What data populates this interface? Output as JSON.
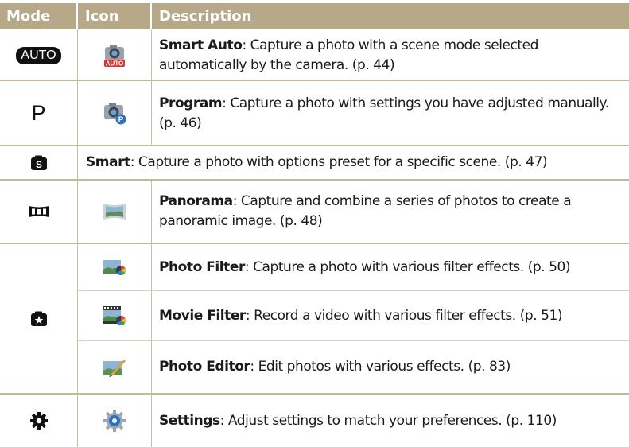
{
  "header": {
    "mode": "Mode",
    "icon": "Icon",
    "description": "Description"
  },
  "colors": {
    "header_bg": "#b7a88a",
    "rule": "#c4b89d"
  },
  "rows": [
    {
      "mode": "AUTO",
      "mode_icon": "auto-badge-icon",
      "icon": "smart-auto-camera-icon",
      "title": "Smart Auto",
      "text": ": Capture a photo with a scene mode selected automatically by the camera. (p. 44)"
    },
    {
      "mode": "P",
      "mode_icon": "program-p-icon",
      "icon": "program-camera-icon",
      "title": "Program",
      "text": ": Capture a photo with settings you have adjusted manually. (p. 46)"
    },
    {
      "mode_icon": "smart-mode-icon",
      "title": "Smart",
      "text": ": Capture a photo with options preset for a specific scene. (p. 47)"
    },
    {
      "mode_icon": "panorama-mode-icon",
      "icon": "panorama-icon",
      "title": "Panorama",
      "text": ": Capture and combine a series of photos to create a panoramic image. (p. 48)"
    },
    {
      "mode_icon": "magic-plus-icon",
      "icon": "photo-filter-icon",
      "title": "Photo Filter",
      "text": ": Capture a photo with various filter effects. (p. 50)"
    },
    {
      "icon": "movie-filter-icon",
      "title": "Movie Filter",
      "text": ": Record a video with various filter effects. (p. 51)"
    },
    {
      "icon": "photo-editor-icon",
      "title": "Photo Editor",
      "text": ": Edit photos with various effects. (p. 83)"
    },
    {
      "mode_icon": "settings-gear-icon",
      "icon": "settings-icon",
      "title": "Settings",
      "text": ": Adjust settings to match your preferences. (p. 110)"
    }
  ]
}
